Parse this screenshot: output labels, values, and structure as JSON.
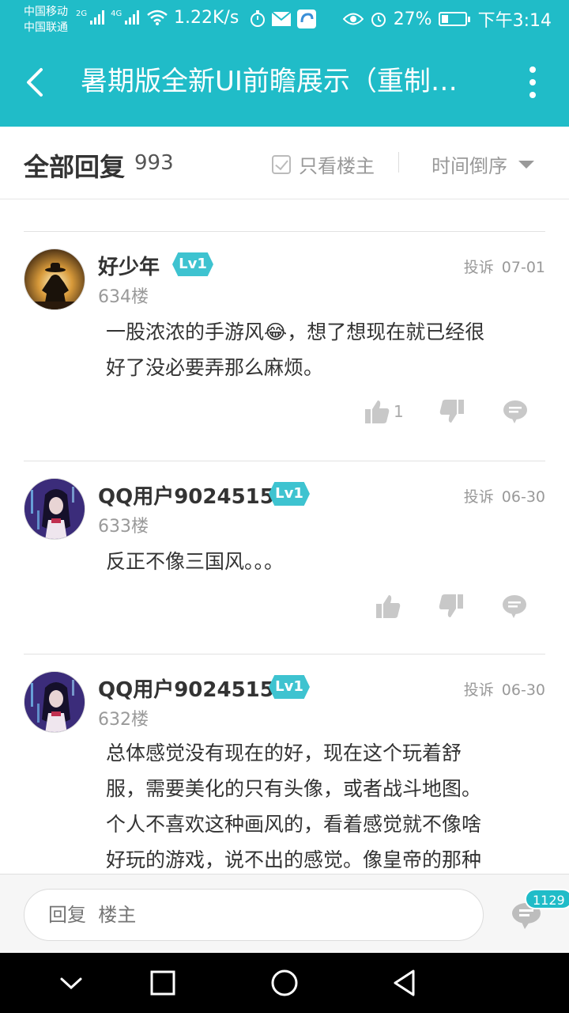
{
  "status_bar": {
    "carrier_1": "中国移动",
    "carrier_2": "中国联通",
    "net_1": "2G",
    "net_2": "4G",
    "speed": "1.22K/s",
    "battery": "27%",
    "battery_level": 0.27,
    "time": "下午3:14"
  },
  "app_bar": {
    "title": "暑期版全新UI前瞻展示（重制…",
    "accent_color": "#20bcc8"
  },
  "filter_bar": {
    "all_replies_label": "全部回复",
    "reply_count": "993",
    "op_only_label": "只看楼主",
    "sort_label": "时间倒序"
  },
  "comments": [
    {
      "username": "好少年",
      "level": "Lv1",
      "report": "投诉",
      "date": "07-01",
      "floor": "634楼",
      "text_1": "一股浓浓的手游风😂，想了想现在就已经很",
      "text_2": "好了没必要弄那么麻烦。",
      "likes": "1"
    },
    {
      "username": "QQ用户9024515",
      "level": "Lv1",
      "report": "投诉",
      "date": "06-30",
      "floor": "633楼",
      "text_1": "反正不像三国风。。。"
    },
    {
      "username": "QQ用户9024515",
      "level": "Lv1",
      "report": "投诉",
      "date": "06-30",
      "floor": "632楼",
      "text_1": "总体感觉没有现在的好，现在这个玩着舒",
      "text_2": "服，需要美化的只有头像，或者战斗地图。",
      "text_3": "个人不喜欢这种画风的，看着感觉就不像啥",
      "text_4": "好玩的游戏，说不出的感觉。像皇帝的那种"
    }
  ],
  "reply_bar": {
    "placeholder": "回复  楼主",
    "comment_count": "1129"
  }
}
